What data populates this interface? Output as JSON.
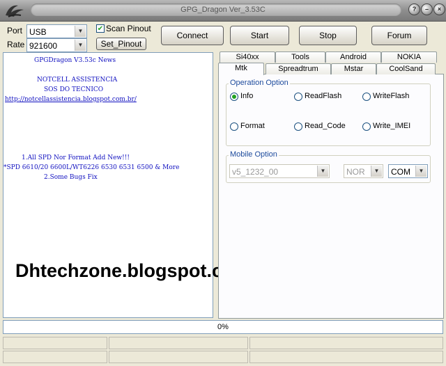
{
  "window": {
    "title": "GPG_Dragon  Ver_3.53C",
    "help_label": "?",
    "minimize_label": "–",
    "close_label": "×"
  },
  "connection": {
    "port_label": "Port",
    "port_value": "USB",
    "rate_label": "Rate",
    "rate_value": "921600",
    "scan_pinout_label": "Scan Pinout",
    "scan_pinout_checked": true,
    "set_pinout_label": "Set_Pinout"
  },
  "toolbar": {
    "connect_label": "Connect",
    "start_label": "Start",
    "stop_label": "Stop",
    "forum_label": "Forum"
  },
  "news": {
    "heading": "GPGDragon V3.53c News",
    "line1": "NOTCELL ASSISTENCIA",
    "line2": "SOS DO TECNICO",
    "link": "http://notcellassistencia.blogspot.com.br/",
    "item1": "1.All SPD Nor Format Add New!!!",
    "item1b": "*SPD 6610/20 6600L/WT6226 6530 6531 6500 & More",
    "item2": "2.Some Bugs Fix"
  },
  "watermark": "Dhtechzone.blogspot.com",
  "tabs": {
    "row1": [
      "Si40xx",
      "Tools",
      "Android",
      "NOKIA"
    ],
    "row2": [
      "Mtk",
      "Spreadtrum",
      "Mstar",
      "CoolSand"
    ],
    "active": "Mtk"
  },
  "operation_option": {
    "title": "Operation Option",
    "options": [
      "Info",
      "ReadFlash",
      "WriteFlash",
      "Format",
      "Read_Code",
      "Write_IMEI"
    ],
    "selected": "Info"
  },
  "mobile_option": {
    "title": "Mobile Option",
    "model_value": "v5_1232_00",
    "memory_value": "NOR",
    "port_value": "COM"
  },
  "progress": {
    "value": 0,
    "text": "0%"
  },
  "colors": {
    "accent_green": "#21a121",
    "news_text": "#1010c0",
    "group_title": "#1c4a9c"
  }
}
